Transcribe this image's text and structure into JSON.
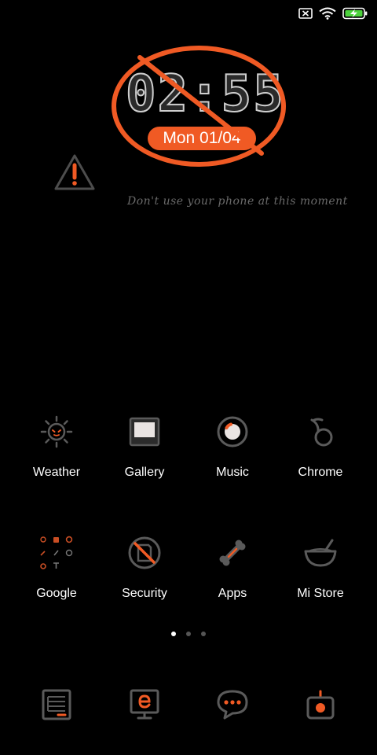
{
  "status_bar": {
    "icons": [
      "sim-none-icon",
      "wifi-icon",
      "battery-charging-icon"
    ]
  },
  "clock": {
    "time": "02:55",
    "date": "Mon 01/04",
    "overlay_icon": "no-symbol-icon"
  },
  "notice": {
    "icon": "warning-icon",
    "text": "Don't use your phone at this moment"
  },
  "apps_row1": [
    {
      "label": "Weather",
      "icon": "sun-icon"
    },
    {
      "label": "Gallery",
      "icon": "image-frame-icon"
    },
    {
      "label": "Music",
      "icon": "disc-icon"
    },
    {
      "label": "Chrome",
      "icon": "knot-icon"
    }
  ],
  "apps_row2": [
    {
      "label": "Google",
      "icon": "folder-grid-icon"
    },
    {
      "label": "Security",
      "icon": "shield-icon"
    },
    {
      "label": "Apps",
      "icon": "bone-icon"
    },
    {
      "label": "Mi Store",
      "icon": "bowl-icon"
    }
  ],
  "page_indicator": {
    "count": 3,
    "active": 1
  },
  "dock": [
    {
      "icon": "notes-icon"
    },
    {
      "icon": "browser-icon"
    },
    {
      "icon": "chat-bubble-icon"
    },
    {
      "icon": "camera-icon"
    }
  ],
  "colors": {
    "accent": "#f05a24",
    "background": "#000000",
    "icon_stroke": "#5a5a5a",
    "charging": "#4cd23c"
  }
}
